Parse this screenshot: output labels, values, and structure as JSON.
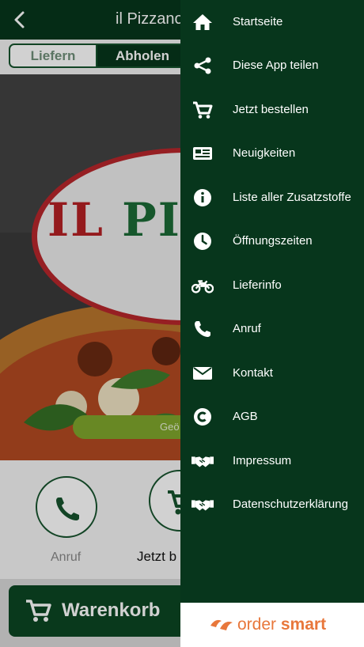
{
  "header": {
    "title": "il Pizzano B"
  },
  "tabs": [
    {
      "label": "Liefern"
    },
    {
      "label": "Abholen"
    }
  ],
  "hero": {
    "logo_left": "IL",
    "logo_right": "PIZ",
    "ribbon_text": "Geö"
  },
  "actions": [
    {
      "label": "Anruf",
      "icon": "phone-icon"
    },
    {
      "label": "Jetzt b",
      "icon": "cart-icon"
    }
  ],
  "cart": {
    "label": "Warenkorb"
  },
  "drawer": {
    "items": [
      {
        "label": "Startseite",
        "icon": "home-icon"
      },
      {
        "label": "Diese App teilen",
        "icon": "share-icon"
      },
      {
        "label": "Jetzt bestellen",
        "icon": "cart-icon"
      },
      {
        "label": "Neuigkeiten",
        "icon": "newspaper-icon"
      },
      {
        "label": "Liste aller Zusatzstoffe",
        "icon": "info-icon"
      },
      {
        "label": "Öffnungszeiten",
        "icon": "clock-icon"
      },
      {
        "label": "Lieferinfo",
        "icon": "motorcycle-icon"
      },
      {
        "label": "Anruf",
        "icon": "phone-icon"
      },
      {
        "label": "Kontakt",
        "icon": "envelope-icon"
      },
      {
        "label": "AGB",
        "icon": "copyright-icon"
      },
      {
        "label": "Impressum",
        "icon": "handshake-icon"
      },
      {
        "label": "Datenschutzerklärung",
        "icon": "handshake-icon"
      }
    ],
    "footer": {
      "brand_light": "order",
      "brand_bold": "smart"
    }
  },
  "colors": {
    "primary": "#07361c",
    "accent": "#e8773b",
    "ribbon": "#7fa62c"
  }
}
